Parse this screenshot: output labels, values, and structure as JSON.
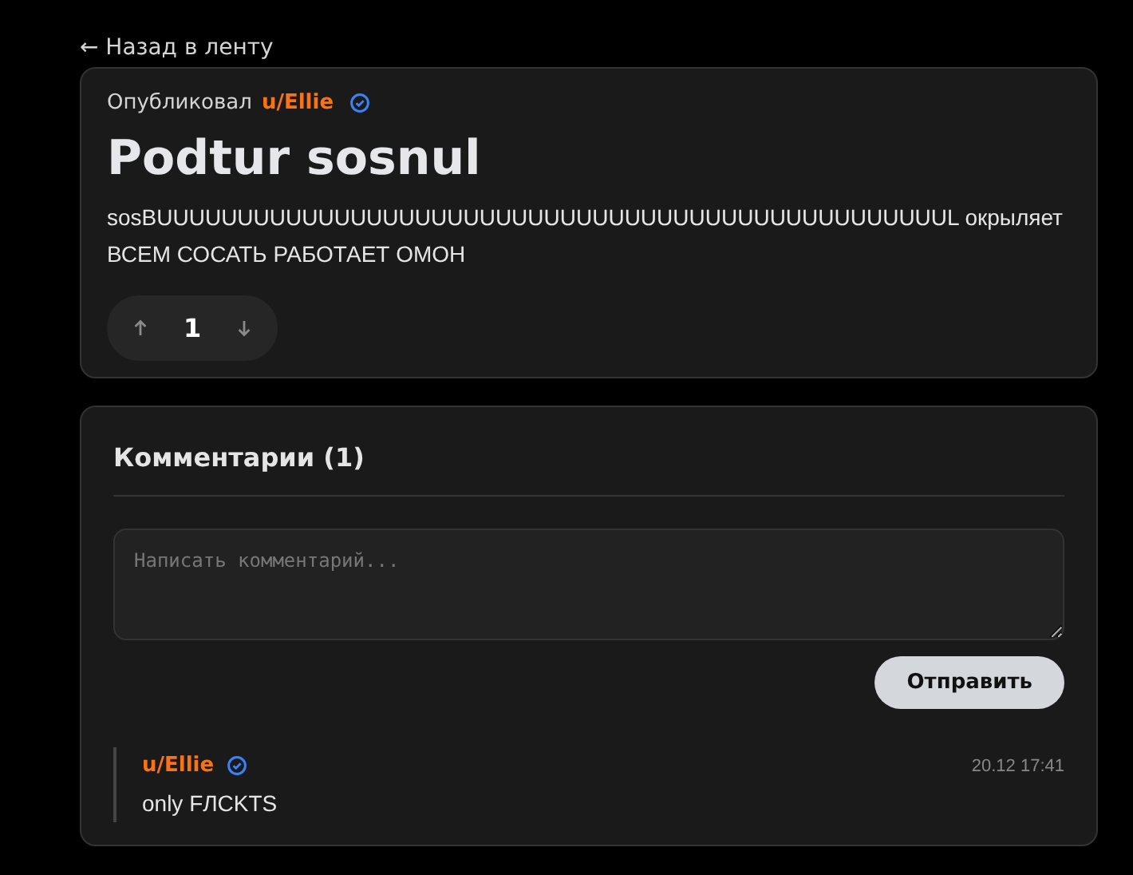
{
  "back_link": "← Назад в ленту",
  "post": {
    "published_by": "Опубликовал",
    "author": "u/Ellie",
    "verified": true,
    "title": "Podtur sosnul",
    "body": [
      "sosBUUUUUUUUUUUUUUUUUUUUUUUUUUUUUUUUUUUUUUUUUUUUUUUUUL окрыляет",
      "ВСЕМ СОСАТЬ РАБОТАЕТ ОМОН"
    ],
    "score": "1"
  },
  "comments": {
    "heading": "Комментарии (1)",
    "placeholder": "Написать комментарий...",
    "submit": "Отправить",
    "items": [
      {
        "author": "u/Ellie",
        "verified": true,
        "time": "20.12 17:41",
        "text": "only FЛCKTS"
      }
    ]
  }
}
